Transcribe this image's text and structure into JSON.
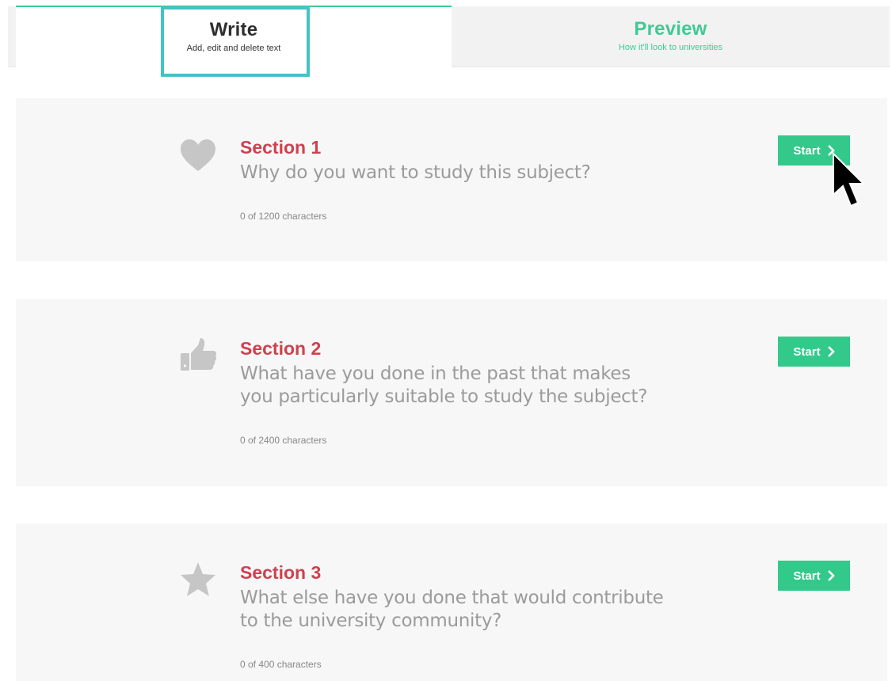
{
  "tabs": {
    "write": {
      "title": "Write",
      "subtitle": "Add, edit and delete text"
    },
    "preview": {
      "title": "Preview",
      "subtitle": "How it'll look to universities"
    }
  },
  "sections": [
    {
      "heading": "Section 1",
      "question": "Why do you want to study this subject?",
      "count": "0 of 1200 characters",
      "button": "Start",
      "icon": "heart-icon"
    },
    {
      "heading": "Section 2",
      "question": "What have you done in the past that makes you particularly suitable to study the subject?",
      "count": "0 of 2400 characters",
      "button": "Start",
      "icon": "thumbs-up-icon"
    },
    {
      "heading": "Section 3",
      "question": "What else have you done that would contribute to the university community?",
      "count": "0 of 400 characters",
      "button": "Start",
      "icon": "star-icon"
    }
  ],
  "colors": {
    "accent": "#3ecb93",
    "button": "#33c98a",
    "heading": "#cf4150",
    "highlight": "#45c2c5",
    "card": "#f7f7f7"
  }
}
